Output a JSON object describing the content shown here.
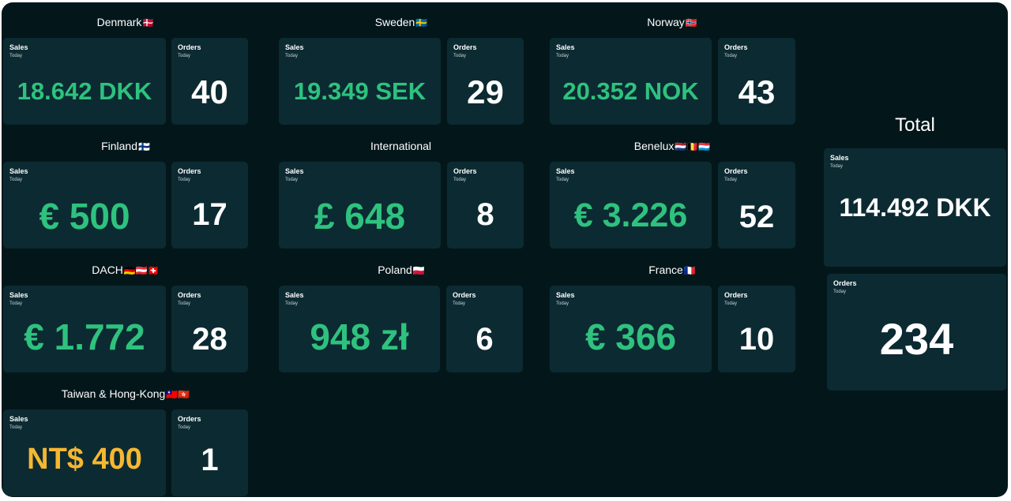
{
  "card_sub_label": "Today",
  "sales_label": "Sales",
  "orders_label": "Orders",
  "regions": [
    {
      "name": "Denmark",
      "flags": "🇩🇰",
      "sales": "18.642 DKK",
      "orders": "40"
    },
    {
      "name": "Sweden",
      "flags": "🇸🇪",
      "sales": "19.349 SEK",
      "orders": "29"
    },
    {
      "name": "Norway",
      "flags": "🇳🇴",
      "sales": "20.352 NOK",
      "orders": "43"
    },
    {
      "name": "Finland",
      "flags": "🇫🇮",
      "sales": "€ 500",
      "orders": "17"
    },
    {
      "name": "International",
      "flags": "",
      "sales": "£ 648",
      "orders": "8"
    },
    {
      "name": "Benelux",
      "flags": "🇳🇱🇧🇪🇱🇺",
      "sales": "€ 3.226",
      "orders": "52"
    },
    {
      "name": "DACH",
      "flags": "🇩🇪🇦🇹🇨🇭",
      "sales": "€ 1.772",
      "orders": "28"
    },
    {
      "name": "Poland",
      "flags": "🇵🇱",
      "sales": "948 zł",
      "orders": "6"
    },
    {
      "name": "France",
      "flags": "🇫🇷",
      "sales": "€ 366",
      "orders": "10"
    },
    {
      "name": "Taiwan & Hong-Kong",
      "flags": "🇹🇼🇭🇰",
      "sales": "NT$ 400",
      "orders": "1"
    }
  ],
  "total": {
    "title": "Total",
    "sales": "114.492 DKK",
    "orders": "234"
  },
  "colors": {
    "background": "#03171b",
    "card": "#0c2a32",
    "sales_green": "#2ec27e",
    "sales_gold": "#f5b731",
    "text_white": "#ffffff"
  }
}
